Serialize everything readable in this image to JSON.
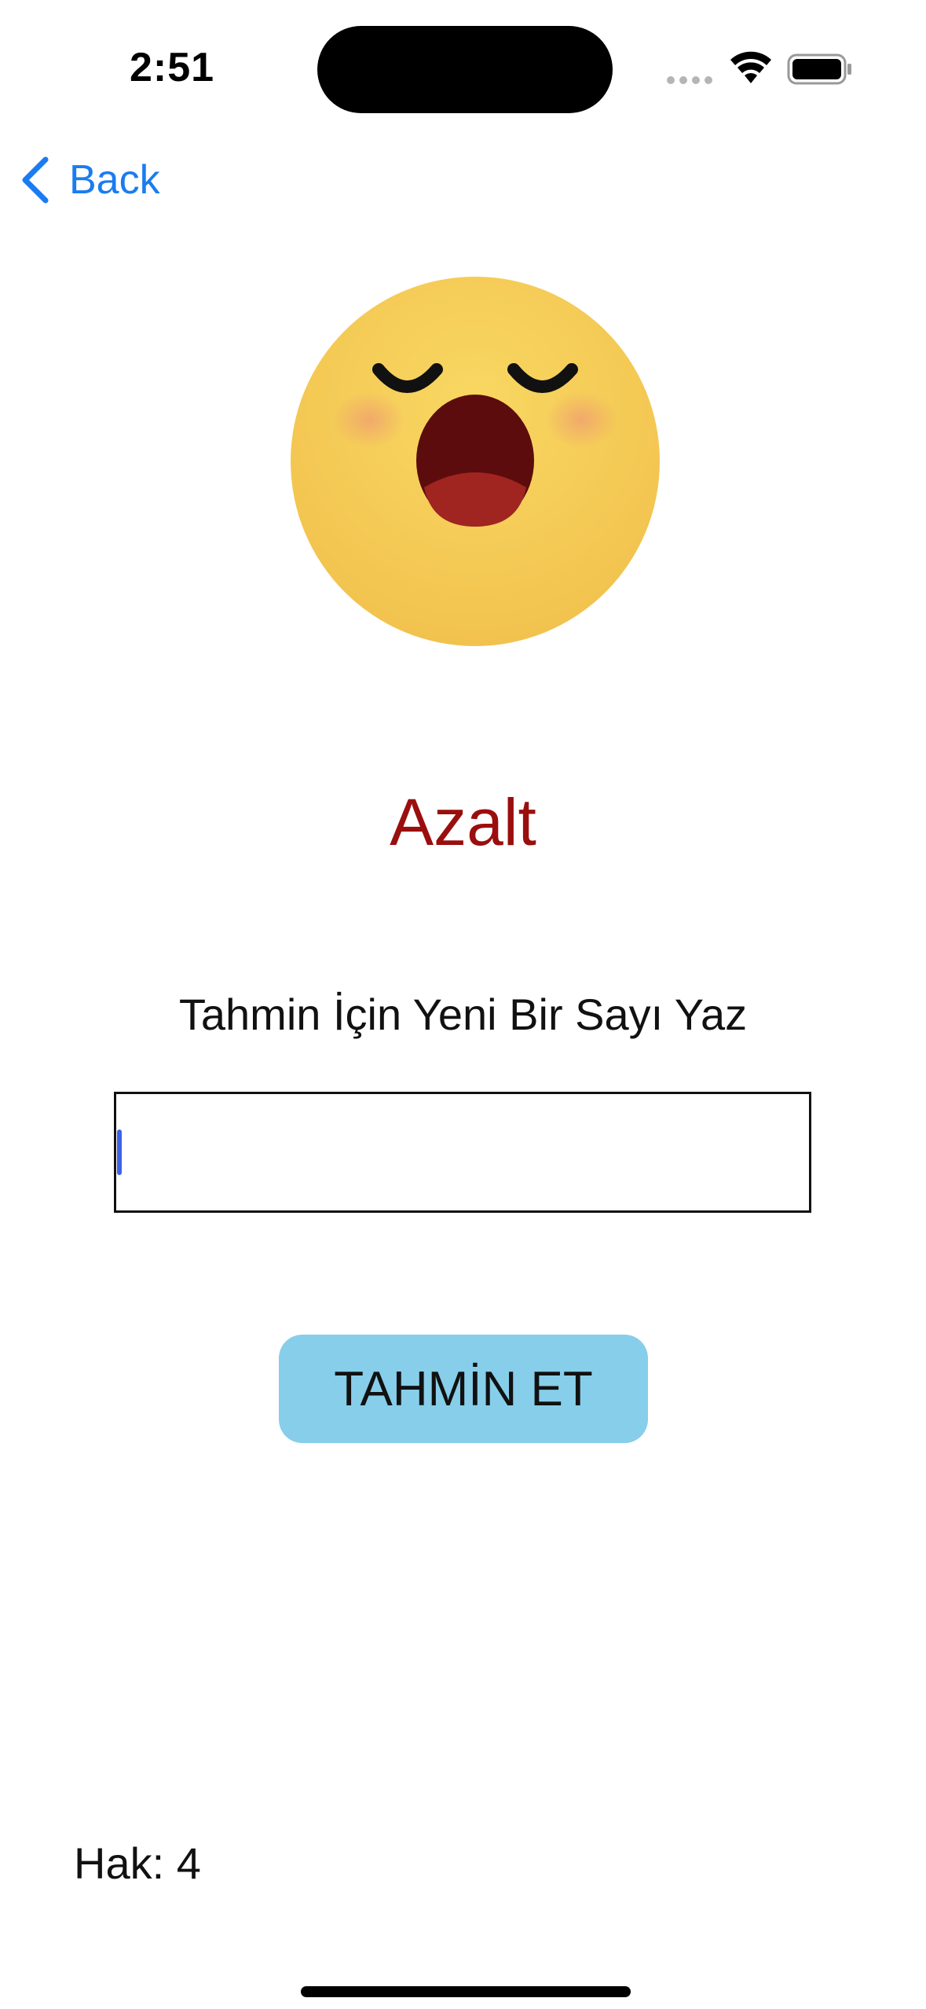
{
  "status_bar": {
    "time": "2:51"
  },
  "nav": {
    "back_label": "Back"
  },
  "emoji": {
    "icon": "yawning-face-icon"
  },
  "hint": {
    "text": "Azalt",
    "color": "#9b0e0e"
  },
  "prompt": {
    "label": "Tahmin İçin Yeni Bir Sayı Yaz"
  },
  "guess_input": {
    "value": "",
    "placeholder": ""
  },
  "guess_button": {
    "label": "TAHMİN ET",
    "color": "#87ceea"
  },
  "remaining": {
    "text": "Hak: 4"
  },
  "accent_color": "#1a7cf0"
}
